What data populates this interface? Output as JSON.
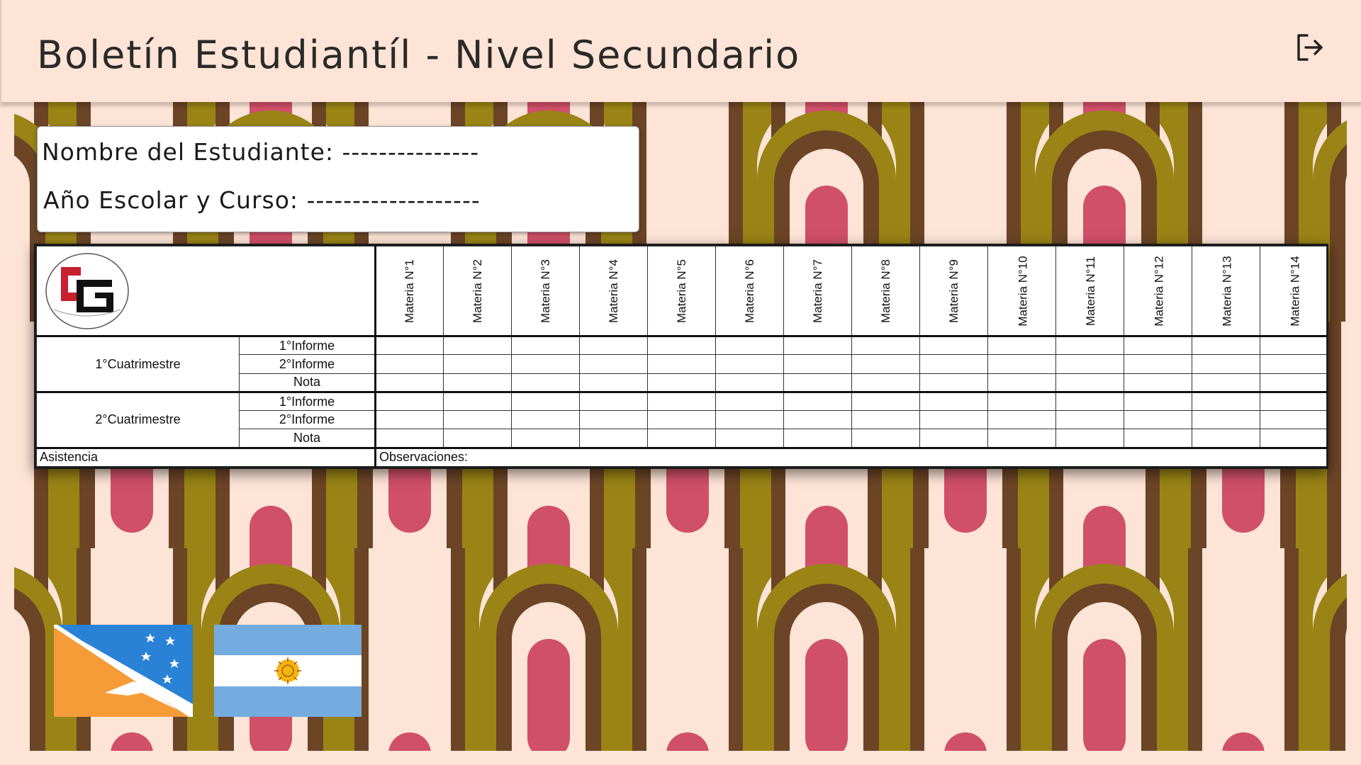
{
  "header": {
    "title": "Boletín Estudiantíl - Nivel Secundario",
    "logout_icon": "logout-icon"
  },
  "student_info": {
    "name_line": "Nombre del Estudiante: ---------------",
    "year_line": "Año Escolar y Curso: -------------------"
  },
  "report_table": {
    "logo_text": "CG",
    "subjects": [
      "Materia N°1",
      "Materia N°2",
      "Materia N°3",
      "Materia N°4",
      "Materia N°5",
      "Materia N°6",
      "Materia N°7",
      "Materia N°8",
      "Materia N°9",
      "Materia N°10",
      "Materia N°11",
      "Materia N°12",
      "Materia N°13",
      "Materia N°14"
    ],
    "terms": [
      {
        "label": "1°Cuatrimestre",
        "rows": [
          "1°Informe",
          "2°Informe",
          "Nota"
        ]
      },
      {
        "label": "2°Cuatrimestre",
        "rows": [
          "1°Informe",
          "2°Informe",
          "Nota"
        ]
      }
    ],
    "attendance_label": "Asistencia",
    "observations_label": "Observaciones:"
  },
  "colors": {
    "background": "#fde4d6",
    "pattern_olive": "#9a8416",
    "pattern_brown": "#6b4526",
    "pattern_pink": "#d05068",
    "pattern_cream": "#fde4d6",
    "logo_red": "#c8202e"
  },
  "flags": [
    "tierra-del-fuego-flag",
    "argentina-flag"
  ]
}
